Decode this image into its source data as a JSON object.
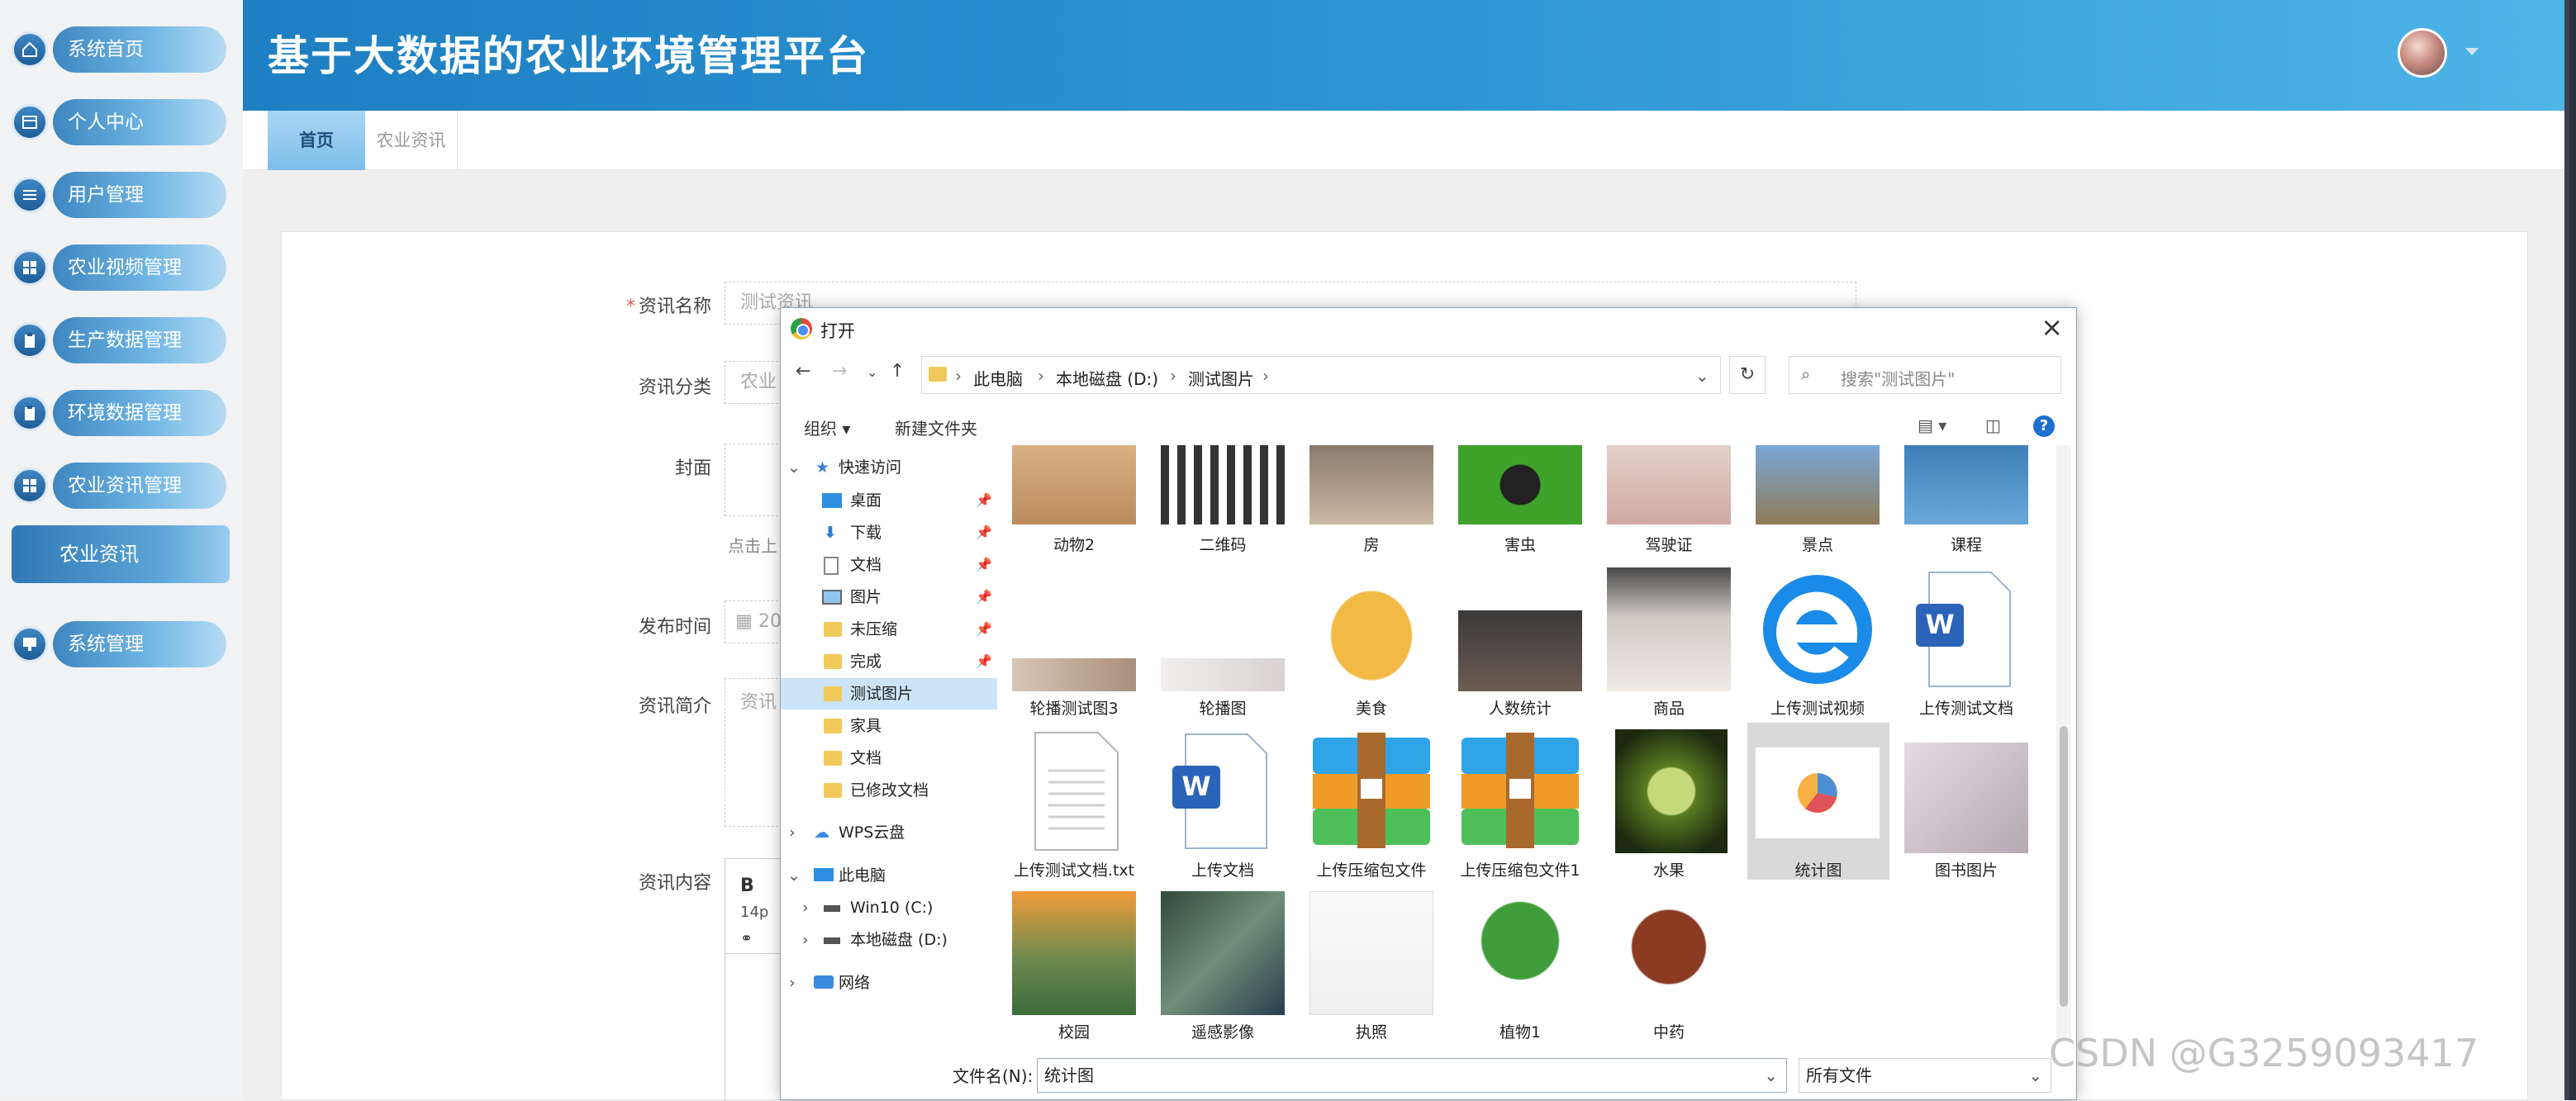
{
  "app": {
    "title": "基于大数据的农业环境管理平台"
  },
  "sidebar": {
    "items": [
      {
        "label": "系统首页",
        "icon": "home-icon"
      },
      {
        "label": "个人中心",
        "icon": "card-icon"
      },
      {
        "label": "用户管理",
        "icon": "sliders-icon"
      },
      {
        "label": "农业视频管理",
        "icon": "grid-icon"
      },
      {
        "label": "生产数据管理",
        "icon": "clipboard-icon"
      },
      {
        "label": "环境数据管理",
        "icon": "clipboard-icon"
      },
      {
        "label": "农业资讯管理",
        "icon": "grid-icon"
      },
      {
        "label": "系统管理",
        "icon": "monitor-icon"
      }
    ],
    "active_sub": "农业资讯"
  },
  "tabs": {
    "home": "首页",
    "news": "农业资讯"
  },
  "form": {
    "name_label": "资讯名称",
    "name_value": "测试资讯",
    "cat_label": "资讯分类",
    "cat_value": "农业",
    "cover_label": "封面",
    "cover_hint": "点击上",
    "time_label": "发布时间",
    "time_value": "20",
    "brief_label": "资讯简介",
    "brief_placeholder": "资讯",
    "content_label": "资讯内容",
    "editor_bold": "B",
    "editor_size": "14p"
  },
  "dialog": {
    "title": "打开",
    "path": [
      "此电脑",
      "本地磁盘 (D:)",
      "测试图片"
    ],
    "search_placeholder": "搜索\"测试图片\"",
    "toolbar": {
      "organize": "组织",
      "new_folder": "新建文件夹"
    },
    "tree": {
      "quick_access": "快速访问",
      "items": [
        "桌面",
        "下载",
        "文档",
        "图片",
        "未压缩",
        "完成",
        "测试图片",
        "家具",
        "文档",
        "已修改文档"
      ],
      "wps": "WPS云盘",
      "this_pc": "此电脑",
      "drive_c": "Win10 (C:)",
      "drive_d": "本地磁盘 (D:)",
      "network": "网络"
    },
    "files": [
      "动物2",
      "二维码",
      "房",
      "害虫",
      "驾驶证",
      "景点",
      "课程",
      "轮播测试图3",
      "轮播图",
      "美食",
      "人数统计",
      "商品",
      "上传测试视频",
      "上传测试文档",
      "上传测试文档.txt",
      "上传文档",
      "上传压缩包文件",
      "上传压缩包文件1",
      "水果",
      "统计图",
      "图书图片",
      "校园",
      "遥感影像",
      "执照",
      "植物1",
      "中药"
    ],
    "filename_label": "文件名(N):",
    "filename_value": "统计图",
    "filetype_value": "所有文件"
  },
  "watermark": "CSDN @G3259093417"
}
